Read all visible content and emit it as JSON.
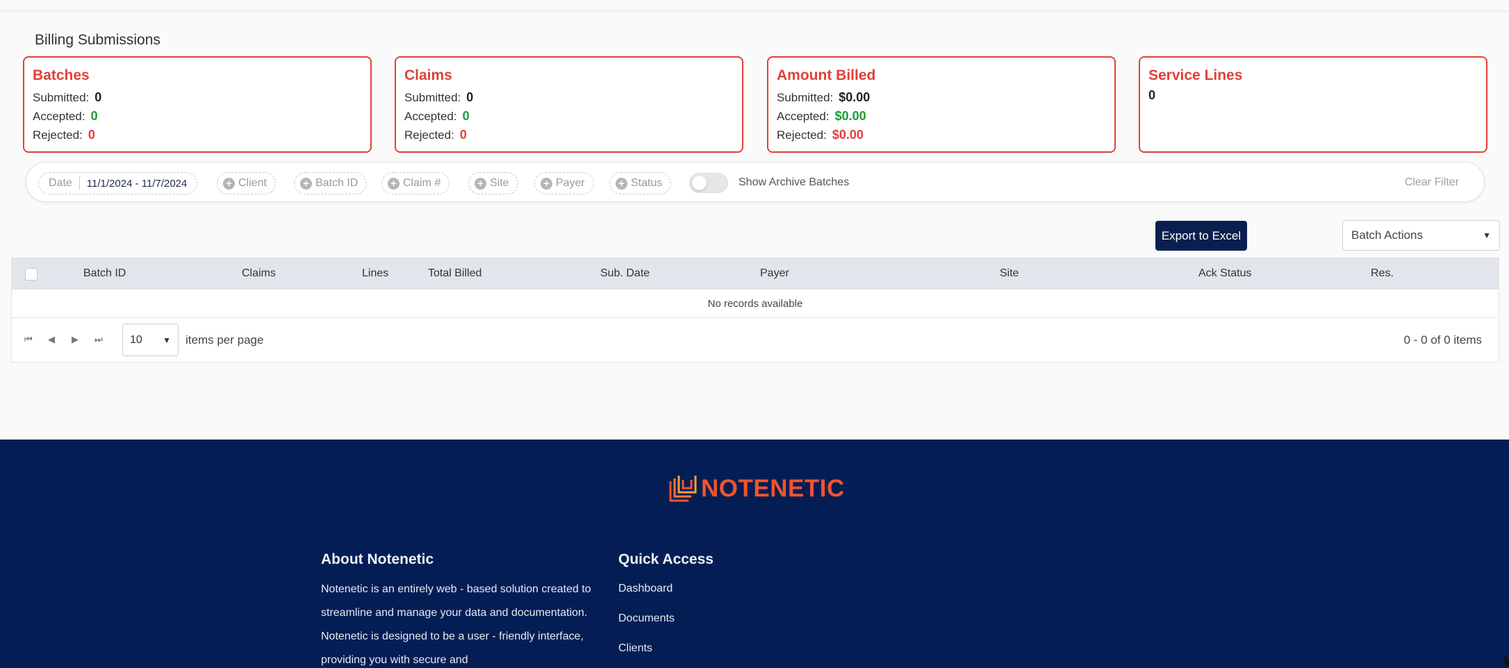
{
  "page": {
    "title": "Billing Submissions"
  },
  "cards": {
    "batches": {
      "title": "Batches",
      "submitted_label": "Submitted:",
      "submitted": "0",
      "accepted_label": "Accepted:",
      "accepted": "0",
      "rejected_label": "Rejected:",
      "rejected": "0"
    },
    "claims": {
      "title": "Claims",
      "submitted_label": "Submitted:",
      "submitted": "0",
      "accepted_label": "Accepted:",
      "accepted": "0",
      "rejected_label": "Rejected:",
      "rejected": "0"
    },
    "amount_billed": {
      "title": "Amount Billed",
      "submitted_label": "Submitted:",
      "submitted": "$0.00",
      "accepted_label": "Accepted:",
      "accepted": "$0.00",
      "rejected_label": "Rejected:",
      "rejected": "$0.00"
    },
    "service_lines": {
      "title": "Service Lines",
      "value": "0"
    }
  },
  "filters": {
    "date_label": "Date",
    "date_value": "11/1/2024 - 11/7/2024",
    "client": "Client",
    "batch_id": "Batch ID",
    "claim": "Claim #",
    "site": "Site",
    "payer": "Payer",
    "status": "Status",
    "archive_toggle_label": "Show Archive Batches",
    "clear": "Clear Filter"
  },
  "toolbar": {
    "export_label": "Export to Excel",
    "batch_actions": "Batch Actions"
  },
  "grid": {
    "columns": [
      "Batch ID",
      "Claims",
      "Lines",
      "Total Billed",
      "Sub. Date",
      "Payer",
      "Site",
      "Ack Status",
      "Res."
    ],
    "empty_text": "No records available"
  },
  "pager": {
    "page_size": "10",
    "per_page_label": "items per page",
    "range": "0 - 0 of 0 items"
  },
  "footer": {
    "brand": "NOTENETIC",
    "about_title": "About Notenetic",
    "about_text": "Notenetic is an entirely web - based solution created to streamline and manage your data and documentation. Notenetic is designed to be a user - friendly interface, providing you with secure and",
    "quick_access_title": "Quick Access",
    "quick_links": [
      "Dashboard",
      "Documents",
      "Clients"
    ]
  },
  "colors": {
    "accent_red": "#e0403a",
    "accent_green": "#1e9b3c",
    "navy": "#041e55",
    "button_navy": "#0b1f4f"
  }
}
